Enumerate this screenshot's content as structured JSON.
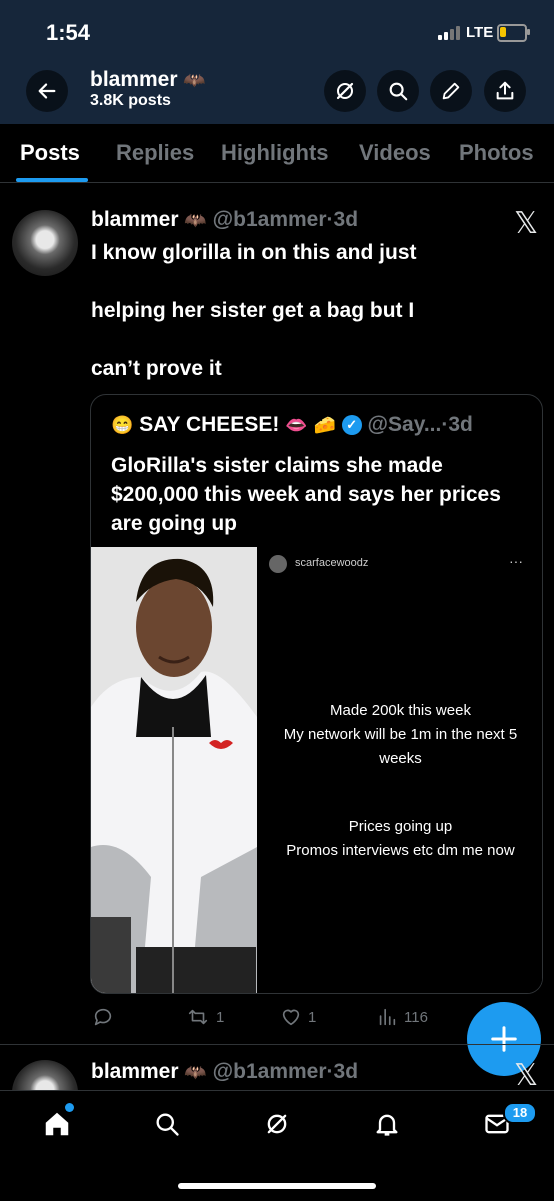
{
  "status_bar": {
    "time": "1:54",
    "network": "LTE"
  },
  "header": {
    "name": "blammer",
    "posts_count": "3.8K posts"
  },
  "tabs": [
    {
      "label": "Posts",
      "active": true
    },
    {
      "label": "Replies"
    },
    {
      "label": "Highlights"
    },
    {
      "label": "Videos"
    },
    {
      "label": "Photos"
    }
  ],
  "post": {
    "author_name": "blammer",
    "author_handle": "@b1ammer",
    "separator": "·",
    "time": "3d",
    "text_lines": [
      "I know glorilla in on this and just",
      "helping her sister get a bag but I",
      "can’t prove it"
    ],
    "quote": {
      "author_name": "SAY CHEESE!",
      "author_handle": "@Say...",
      "time": "3d",
      "text": "GloRilla's sister claims she made $200,000 this week and says her prices are going up",
      "image_username": "scarfacewoodz",
      "image_more": "···",
      "image_text_1": [
        "Made 200k this week",
        "My network will be 1m in the next 5",
        "weeks"
      ],
      "image_text_2": [
        "Prices going up",
        "Promos interviews etc dm me now"
      ]
    },
    "stats": {
      "replies": "",
      "reposts": "1",
      "likes": "1",
      "views": "116"
    }
  },
  "next_post": {
    "author_name": "blammer",
    "author_handle": "@b1ammer",
    "time": "3d"
  },
  "bottom_nav": {
    "messages_badge": "18"
  },
  "colors": {
    "accent": "#1d9bf0",
    "background": "#000000",
    "header_bg": "#16263a",
    "muted": "#71767b"
  }
}
